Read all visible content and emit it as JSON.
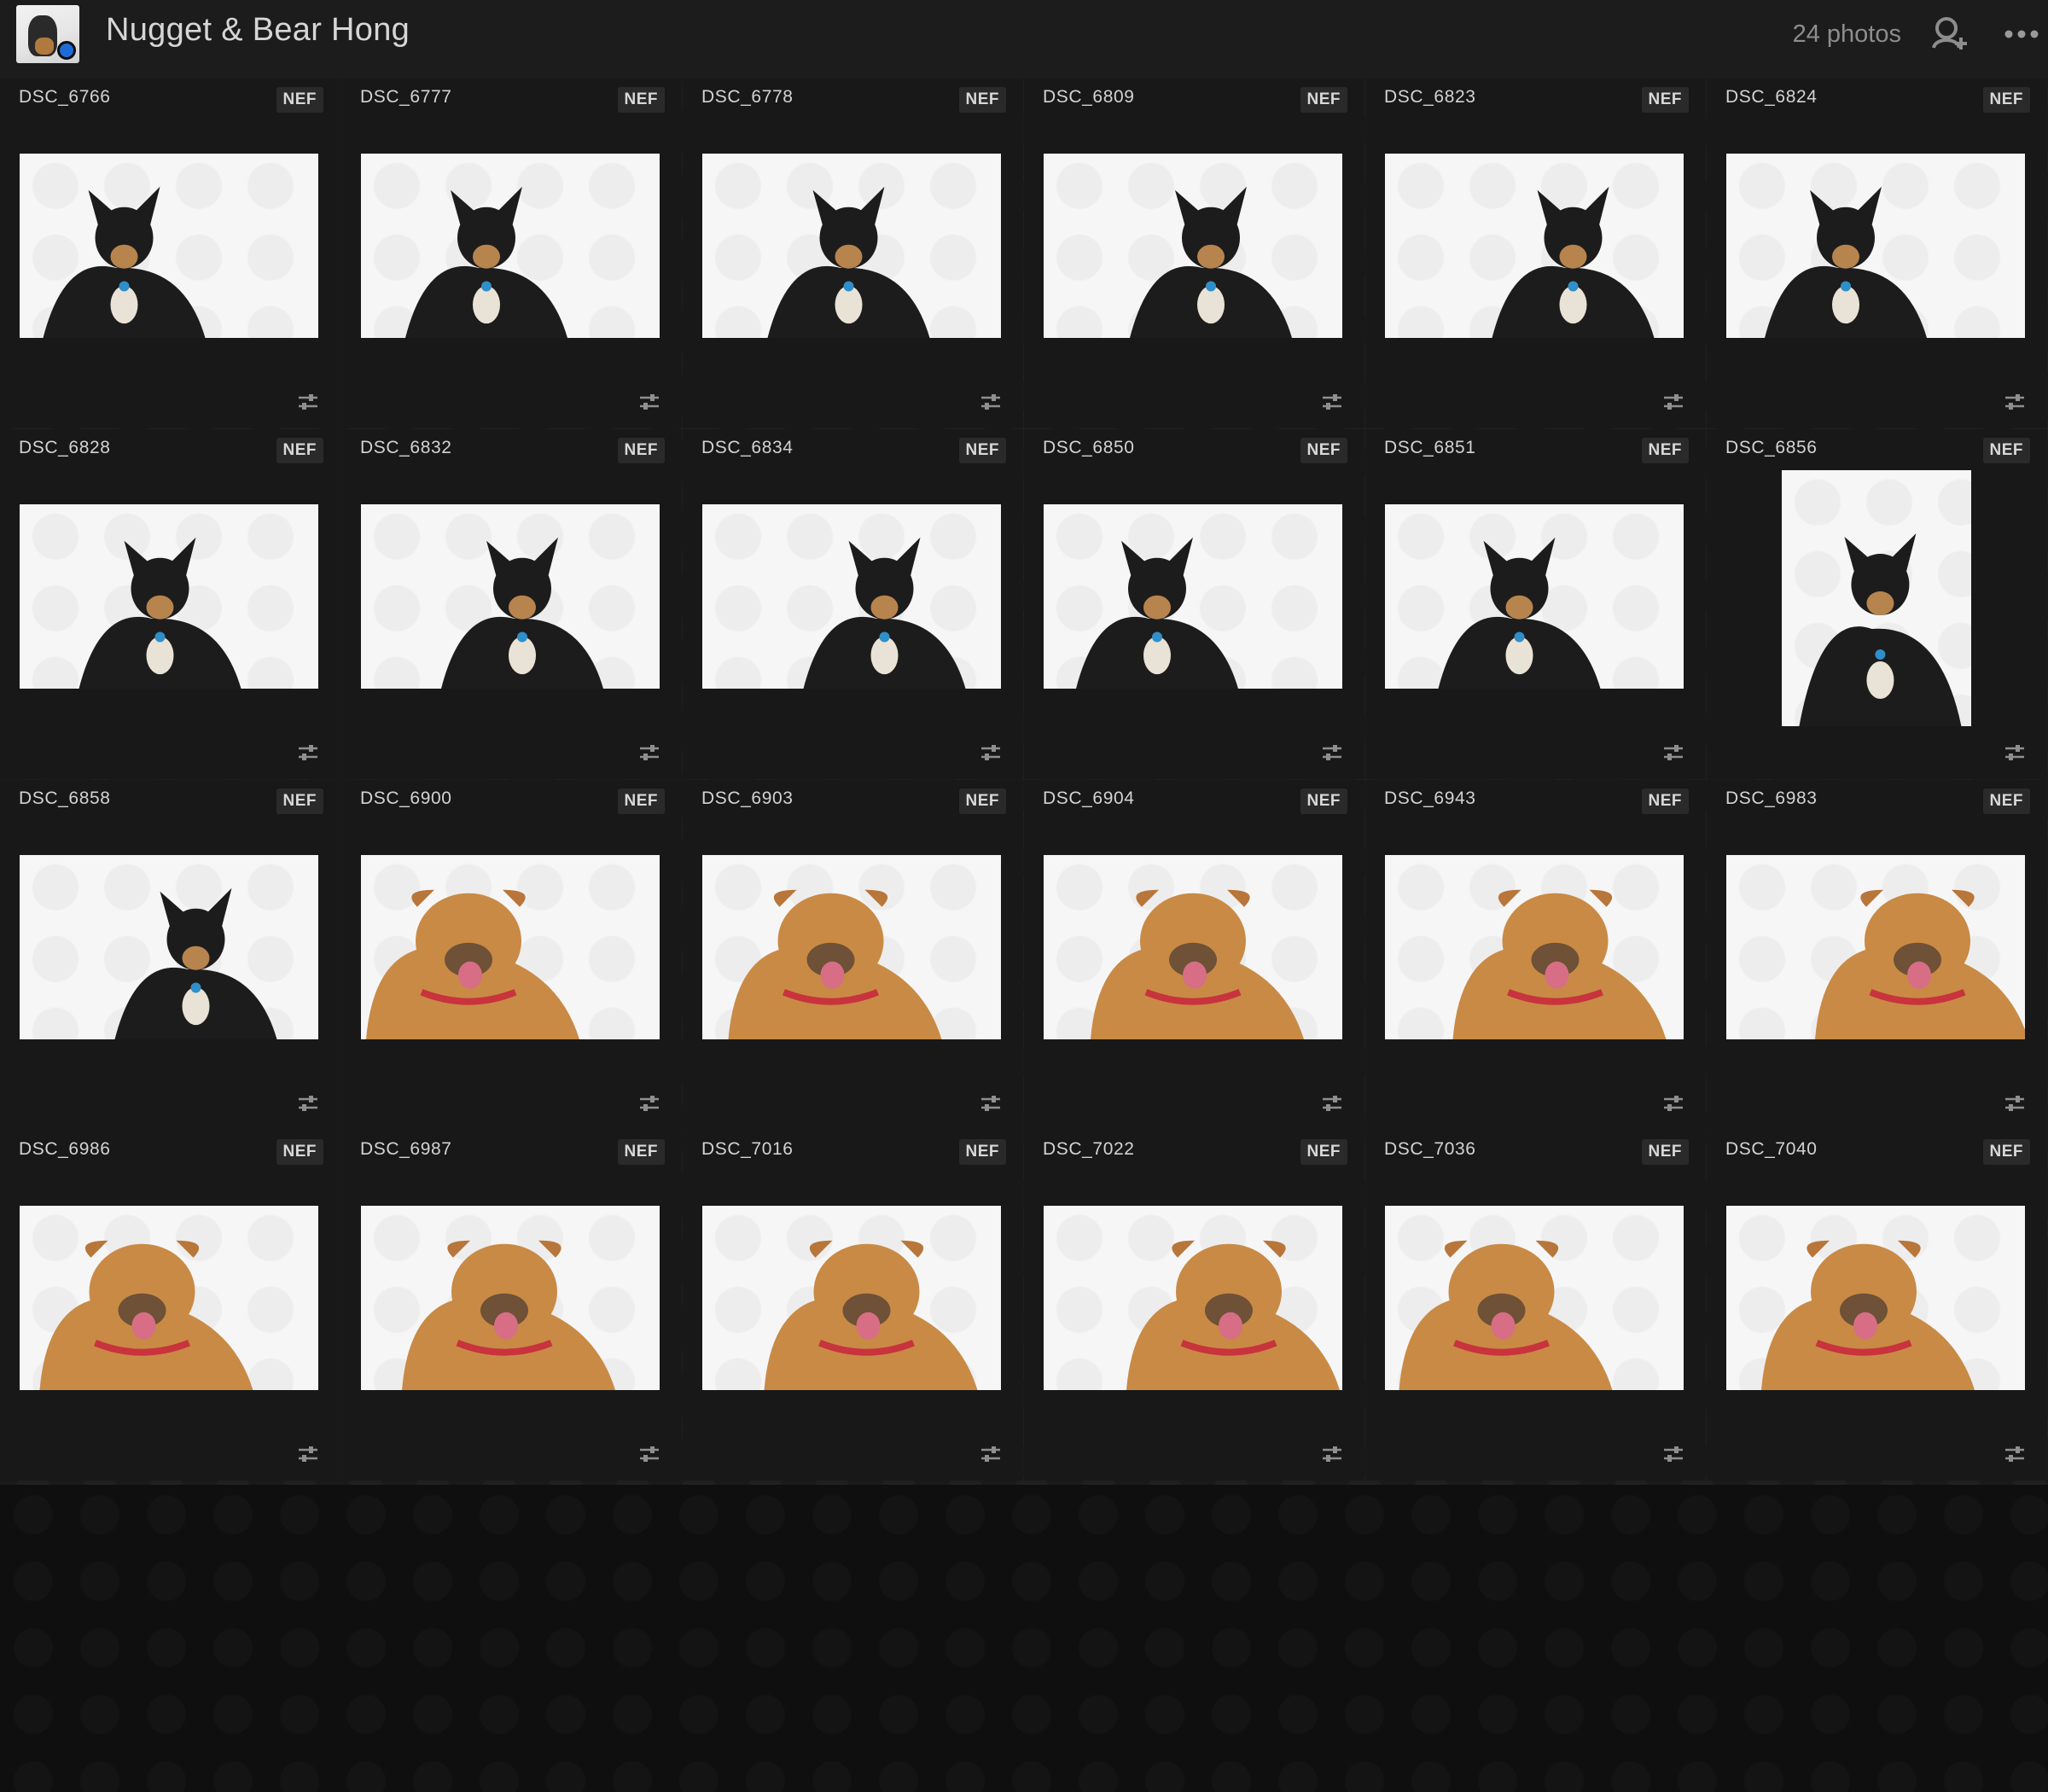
{
  "header": {
    "title": "Nugget & Bear Hong",
    "photo_count": "24 photos",
    "avatar_icon": "album-cover-thumbnail",
    "add_person_icon": "add-person-icon",
    "more_icon": "more-icon"
  },
  "colors": {
    "background": "#1a1a1b",
    "header": "#1c1c1d",
    "accent_blue": "#1f6bd6",
    "black_dog_coat": "#1d1c1c",
    "tan_dog_coat": "#c98a45"
  },
  "photos": [
    {
      "name": "DSC_6766",
      "type": "NEF",
      "dog": "black"
    },
    {
      "name": "DSC_6777",
      "type": "NEF",
      "dog": "black"
    },
    {
      "name": "DSC_6778",
      "type": "NEF",
      "dog": "black"
    },
    {
      "name": "DSC_6809",
      "type": "NEF",
      "dog": "black"
    },
    {
      "name": "DSC_6823",
      "type": "NEF",
      "dog": "black"
    },
    {
      "name": "DSC_6824",
      "type": "NEF",
      "dog": "black"
    },
    {
      "name": "DSC_6828",
      "type": "NEF",
      "dog": "black"
    },
    {
      "name": "DSC_6832",
      "type": "NEF",
      "dog": "black"
    },
    {
      "name": "DSC_6834",
      "type": "NEF",
      "dog": "black"
    },
    {
      "name": "DSC_6850",
      "type": "NEF",
      "dog": "black"
    },
    {
      "name": "DSC_6851",
      "type": "NEF",
      "dog": "black"
    },
    {
      "name": "DSC_6856",
      "type": "NEF",
      "dog": "black",
      "orientation": "portrait"
    },
    {
      "name": "DSC_6858",
      "type": "NEF",
      "dog": "black"
    },
    {
      "name": "DSC_6900",
      "type": "NEF",
      "dog": "tan"
    },
    {
      "name": "DSC_6903",
      "type": "NEF",
      "dog": "tan"
    },
    {
      "name": "DSC_6904",
      "type": "NEF",
      "dog": "tan"
    },
    {
      "name": "DSC_6943",
      "type": "NEF",
      "dog": "tan"
    },
    {
      "name": "DSC_6983",
      "type": "NEF",
      "dog": "tan"
    },
    {
      "name": "DSC_6986",
      "type": "NEF",
      "dog": "tan"
    },
    {
      "name": "DSC_6987",
      "type": "NEF",
      "dog": "tan"
    },
    {
      "name": "DSC_7016",
      "type": "NEF",
      "dog": "tan"
    },
    {
      "name": "DSC_7022",
      "type": "NEF",
      "dog": "tan"
    },
    {
      "name": "DSC_7036",
      "type": "NEF",
      "dog": "tan"
    },
    {
      "name": "DSC_7040",
      "type": "NEF",
      "dog": "tan"
    }
  ]
}
